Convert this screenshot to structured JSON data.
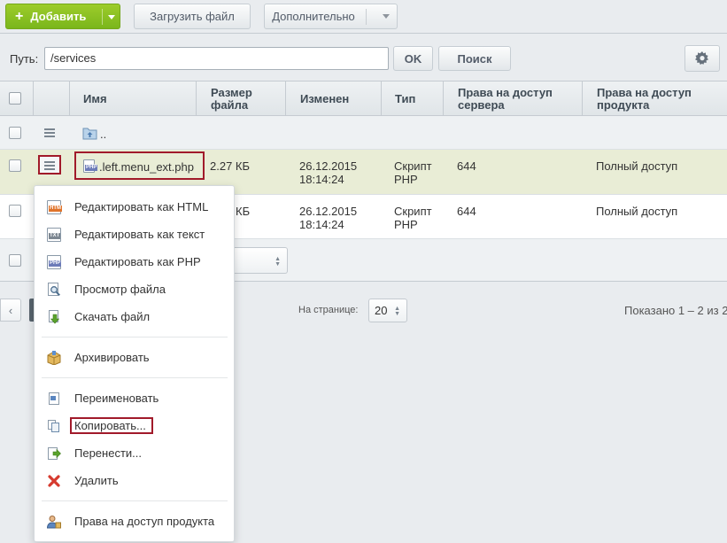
{
  "toolbar": {
    "add_label": "Добавить",
    "upload_label": "Загрузить файл",
    "more_label": "Дополнительно"
  },
  "pathbar": {
    "label": "Путь:",
    "value": "/services",
    "ok_label": "OK",
    "search_label": "Поиск"
  },
  "table": {
    "columns": [
      "Имя",
      "Размер файла",
      "Изменен",
      "Тип",
      "Права на доступ сервера",
      "Права на доступ продукта"
    ],
    "rows": [
      {
        "name": "..",
        "size": "",
        "modified": "",
        "type": "",
        "server_rights": "",
        "product_rights": ""
      },
      {
        "name": ".left.menu_ext.php",
        "size": "2.27 КБ",
        "modified": "26.12.2015 18:14:24",
        "type": "Скрипт PHP",
        "server_rights": "644",
        "product_rights": "Полный доступ"
      },
      {
        "name": "",
        "size": "КБ",
        "modified": "26.12.2015 18:14:24",
        "type": "Скрипт PHP",
        "server_rights": "644",
        "product_rights": "Полный доступ"
      }
    ]
  },
  "context_menu": {
    "items": [
      {
        "label": "Редактировать как HTML",
        "icon": "edit-html-icon"
      },
      {
        "label": "Редактировать как текст",
        "icon": "edit-text-icon"
      },
      {
        "label": "Редактировать как PHP",
        "icon": "edit-php-icon"
      },
      {
        "label": "Просмотр файла",
        "icon": "view-file-icon"
      },
      {
        "label": "Скачать файл",
        "icon": "download-icon"
      },
      {
        "label": "Архивировать",
        "icon": "archive-icon"
      },
      {
        "label": "Переименовать",
        "icon": "rename-icon"
      },
      {
        "label": "Копировать...",
        "icon": "copy-icon"
      },
      {
        "label": "Перенести...",
        "icon": "move-icon"
      },
      {
        "label": "Удалить",
        "icon": "delete-icon"
      },
      {
        "label": "Права на доступ продукта",
        "icon": "access-rights-icon"
      }
    ]
  },
  "pager": {
    "per_page_label": "На странице:",
    "per_page_value": "20",
    "shown_text": "Показано 1 – 2 из 2"
  },
  "colors": {
    "accent_green": "#8cc226",
    "highlight_row": "#e9edd6",
    "selection_outline": "#a11a2a"
  }
}
